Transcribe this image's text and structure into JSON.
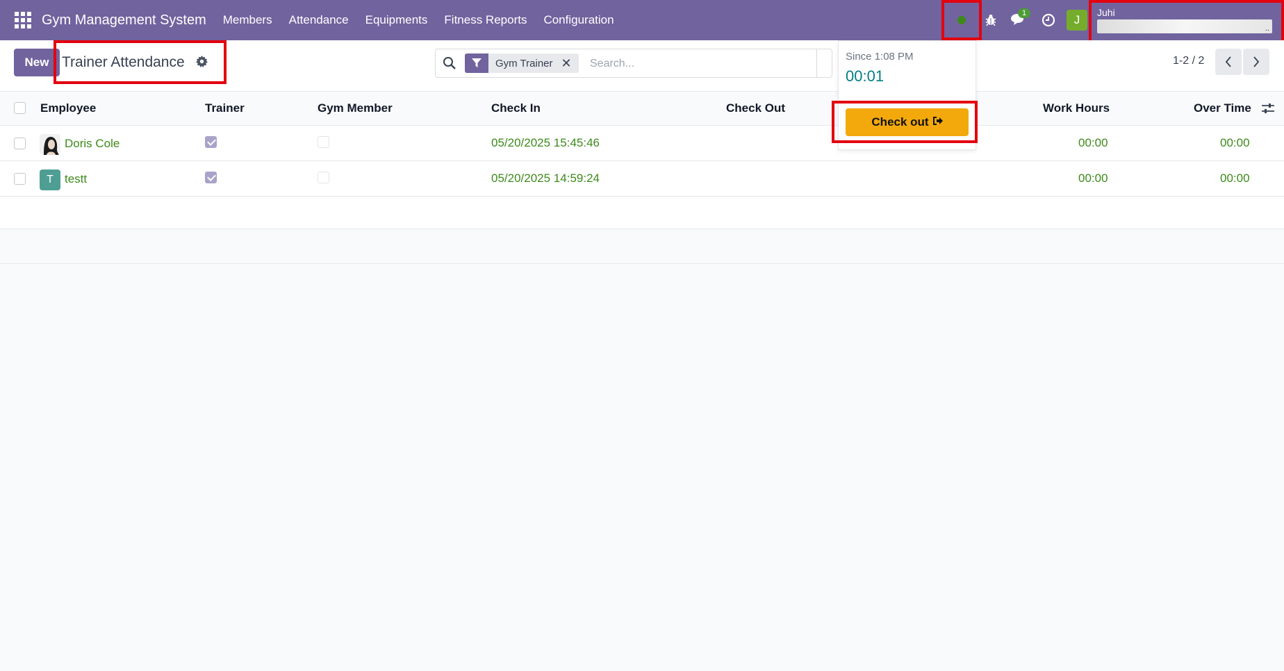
{
  "navbar": {
    "brand": "Gym Management System",
    "menu": [
      "Members",
      "Attendance",
      "Equipments",
      "Fitness Reports",
      "Configuration"
    ],
    "chat_count": "1",
    "user_initial": "J",
    "user_name": "Juhi",
    "user_sub_ellipsis": ".."
  },
  "control": {
    "new_label": "New",
    "title": "Trainer Attendance",
    "facet_label": "Gym Trainer",
    "facet_remove": "✕",
    "search_placeholder": "Search...",
    "pager": "1-2 / 2"
  },
  "popover": {
    "since": "Since 1:08 PM",
    "timer": "00:01",
    "checkout_label": "Check out"
  },
  "table": {
    "columns": {
      "employee": "Employee",
      "trainer": "Trainer",
      "gym_member": "Gym Member",
      "check_in": "Check In",
      "check_out": "Check Out",
      "work_hours": "Work Hours",
      "over_time": "Over Time"
    },
    "rows": [
      {
        "employee": "Doris Cole",
        "avatar": "photo",
        "trainer": true,
        "gym_member": false,
        "check_in": "05/20/2025 15:45:46",
        "check_out": "",
        "work_hours": "00:00",
        "over_time": "00:00"
      },
      {
        "employee": "testt",
        "avatar": "T",
        "trainer": true,
        "gym_member": false,
        "check_in": "05/20/2025 14:59:24",
        "check_out": "",
        "work_hours": "00:00",
        "over_time": "00:00"
      }
    ]
  },
  "icons": {
    "apps": "apps-grid-icon",
    "presence": "presence-dot-icon",
    "debug": "bug-icon",
    "chat": "chat-icon",
    "activity": "clock-icon",
    "gear": "gear-icon",
    "search": "search-icon",
    "filter": "filter-icon",
    "optional_columns": "sliders-icon"
  },
  "colors": {
    "brand": "#71639e",
    "link": "#3c8a1a",
    "checkout": "#f3a90b",
    "timer": "#017e84",
    "highlight": "#e3000f"
  }
}
